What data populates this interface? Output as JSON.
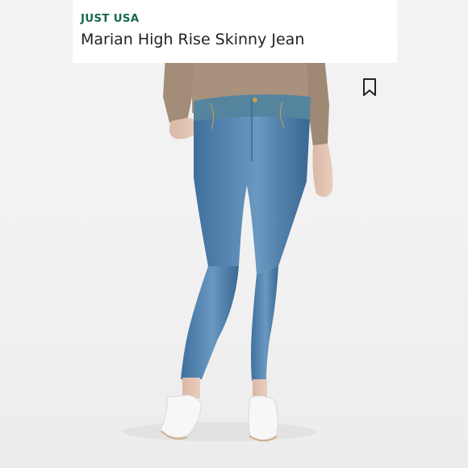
{
  "listing": {
    "brand": "JUST USA",
    "title": "Marian High Rise Skinny Jean"
  },
  "icons": {
    "bookmark": "bookmark-icon"
  },
  "colors": {
    "brand": "#1a6b53",
    "title": "#222222",
    "denim": "#4e7fab",
    "sweater": "#a8917d"
  }
}
